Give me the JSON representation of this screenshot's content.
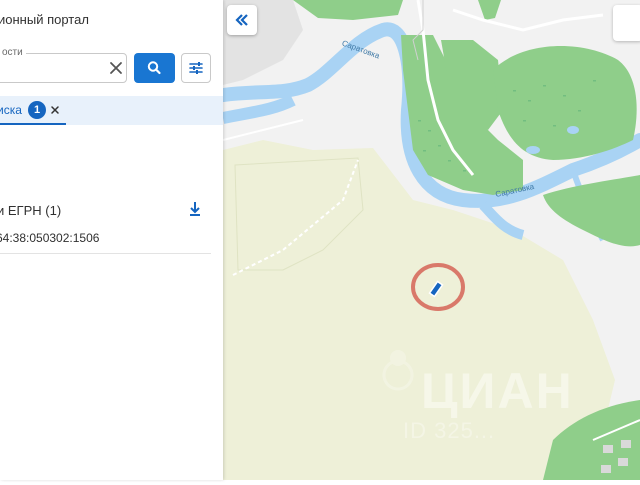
{
  "sidebar": {
    "portal_title": "ионный портал",
    "search": {
      "label": "ости",
      "value": ""
    },
    "tab": {
      "label": "иска",
      "count": "1"
    },
    "results": {
      "header": "и ЕГРН (1)",
      "items": [
        "64:38:050302:1506"
      ]
    }
  },
  "map": {
    "labels": {
      "river_1": "Саратовка",
      "river_2": "Саратовка"
    },
    "watermark": "ЦИАН",
    "watermark_sub": "ID 325..."
  },
  "colors": {
    "accent": "#1565c0",
    "button": "#1976d2",
    "tab_strip": "#e8f1fb",
    "water": "#a9d3f4",
    "forest": "#8fce8a",
    "field": "#eef0d8",
    "highlight": "#d9796a"
  },
  "icons": {
    "clear": "close-icon",
    "search": "search-icon",
    "filter": "tune-icon",
    "tab_close": "close-icon",
    "download": "download-icon",
    "collapse": "double-chevron-left-icon"
  }
}
